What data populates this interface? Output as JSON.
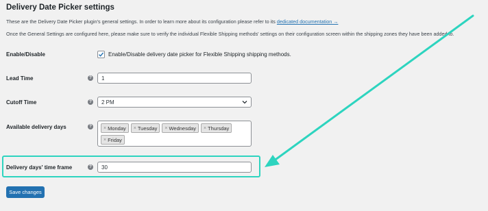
{
  "page": {
    "title": "Delivery Date Picker settings",
    "desc1": "These are the Delivery Date Picker plugin's general settings. In order to learn more about its configuration please refer to its",
    "desc1_link": "dedicated documentation →",
    "desc2": "Once the General Settings are configured here, please make sure to verify the individual Flexible Shipping methods' settings on their configuration screen within the shipping zones they have been added to."
  },
  "fields": {
    "enable": {
      "label": "Enable/Disable",
      "checkbox_label": "Enable/Disable delivery date picker for Flexible Shipping shipping methods."
    },
    "lead_time": {
      "label": "Lead Time",
      "value": "1"
    },
    "cutoff_time": {
      "label": "Cutoff Time",
      "value": "2 PM"
    },
    "delivery_days": {
      "label": "Available delivery days",
      "chips": [
        "Monday",
        "Tuesday",
        "Wednesday",
        "Thursday",
        "Friday"
      ],
      "remove_glyph": "×"
    },
    "time_frame": {
      "label": "Delivery days' time frame",
      "value": "30"
    }
  },
  "save_button": "Save changes",
  "help_glyph": "?",
  "colors": {
    "accent": "#2271b1",
    "highlight": "#2dd4bf"
  }
}
